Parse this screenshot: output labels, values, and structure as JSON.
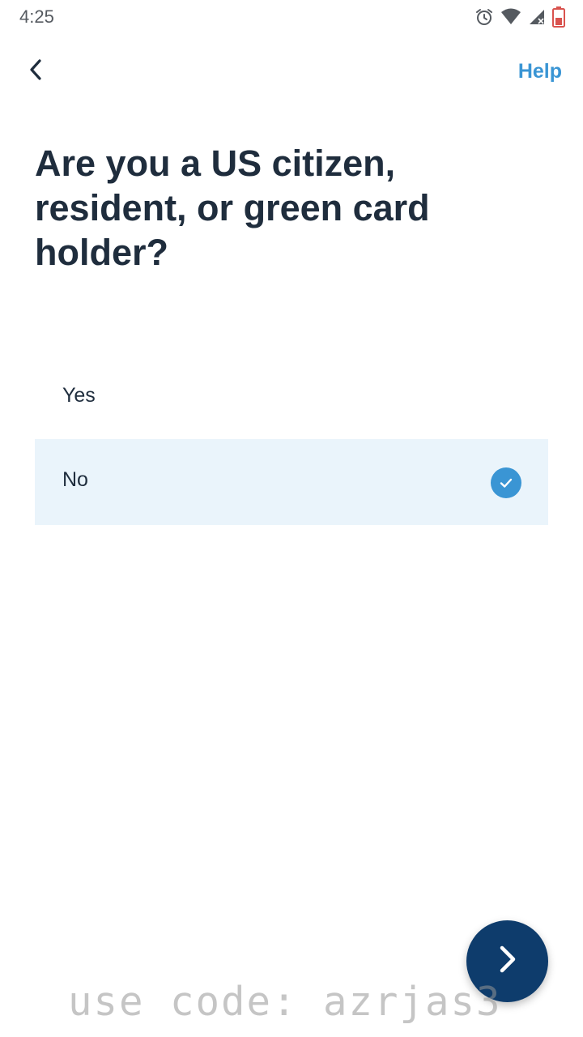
{
  "status_bar": {
    "time": "4:25",
    "icons": [
      "alarm-icon",
      "wifi-icon",
      "signal-icon",
      "battery-icon"
    ]
  },
  "nav": {
    "back_icon": "chevron-left-icon",
    "help_label": "Help"
  },
  "question": {
    "title": "Are you a US citizen, resident, or green card holder?"
  },
  "options": [
    {
      "label": "Yes",
      "selected": false
    },
    {
      "label": "No",
      "selected": true
    }
  ],
  "next_button": {
    "icon": "chevron-right-icon"
  },
  "watermark": {
    "text": "use code: azrjas3"
  },
  "colors": {
    "accent": "#3a95d4",
    "heading": "#1f2d3d",
    "selected_bg": "#eaf4fb",
    "fab_bg": "#0e3c6c"
  }
}
